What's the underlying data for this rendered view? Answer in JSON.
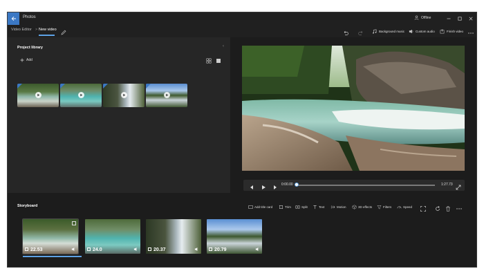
{
  "app": {
    "title": "Photos",
    "status": "Offline"
  },
  "breadcrumb": {
    "root": "Video Editor",
    "current": "New video",
    "separator": ">"
  },
  "toolbar": {
    "background_music": "Background music",
    "custom_audio": "Custom audio",
    "finish_video": "Finish video"
  },
  "library": {
    "title": "Project library",
    "add_label": "Add"
  },
  "player": {
    "current_time": "0:00.00",
    "total_time": "1:27.73",
    "progress": 0
  },
  "storyboard": {
    "title": "Storyboard",
    "actions": {
      "add_title_card": "Add title card",
      "trim": "Trim",
      "split": "Split",
      "text": "Text",
      "motion": "Motion",
      "effects_3d": "3D effects",
      "filters": "Filters",
      "speed": "Speed"
    },
    "clips": [
      {
        "duration": "22.53",
        "selected": true
      },
      {
        "duration": "24.0",
        "selected": false
      },
      {
        "duration": "20.37",
        "selected": false
      },
      {
        "duration": "20.79",
        "selected": false
      }
    ]
  },
  "colors": {
    "accent": "#3b78c4",
    "highlight": "#5ea2e6",
    "panel": "#262626",
    "background": "#1c1c1c"
  }
}
